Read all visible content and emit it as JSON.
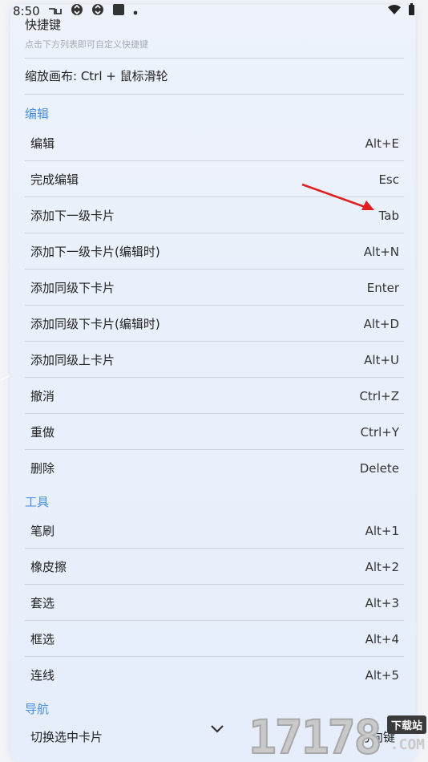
{
  "status": {
    "time": "8:50"
  },
  "panel": {
    "title": "快捷键",
    "subtitle": "点击下方列表即可自定义快捷键",
    "zoom_hint": "缩放画布: Ctrl + 鼠标滑轮"
  },
  "groups": {
    "edit": {
      "label": "编辑",
      "items": [
        {
          "label": "编辑",
          "key": "Alt+E"
        },
        {
          "label": "完成编辑",
          "key": "Esc"
        },
        {
          "label": "添加下一级卡片",
          "key": "Tab"
        },
        {
          "label": "添加下一级卡片(编辑时)",
          "key": "Alt+N"
        },
        {
          "label": "添加同级下卡片",
          "key": "Enter"
        },
        {
          "label": "添加同级下卡片(编辑时)",
          "key": "Alt+D"
        },
        {
          "label": "添加同级上卡片",
          "key": "Alt+U"
        },
        {
          "label": "撤消",
          "key": "Ctrl+Z"
        },
        {
          "label": "重做",
          "key": "Ctrl+Y"
        },
        {
          "label": "删除",
          "key": "Delete"
        }
      ]
    },
    "tools": {
      "label": "工具",
      "items": [
        {
          "label": "笔刷",
          "key": "Alt+1"
        },
        {
          "label": "橡皮擦",
          "key": "Alt+2"
        },
        {
          "label": "套选",
          "key": "Alt+3"
        },
        {
          "label": "框选",
          "key": "Alt+4"
        },
        {
          "label": "连线",
          "key": "Alt+5"
        }
      ]
    },
    "nav": {
      "label": "导航",
      "items": [
        {
          "label": "切换选中卡片",
          "key": "方向键"
        }
      ]
    }
  },
  "watermark": {
    "digits": "17178",
    "badge": "下载站",
    "suffix": ".COM"
  },
  "colors": {
    "accent": "#4a90e2",
    "arrow": "#e02020"
  }
}
